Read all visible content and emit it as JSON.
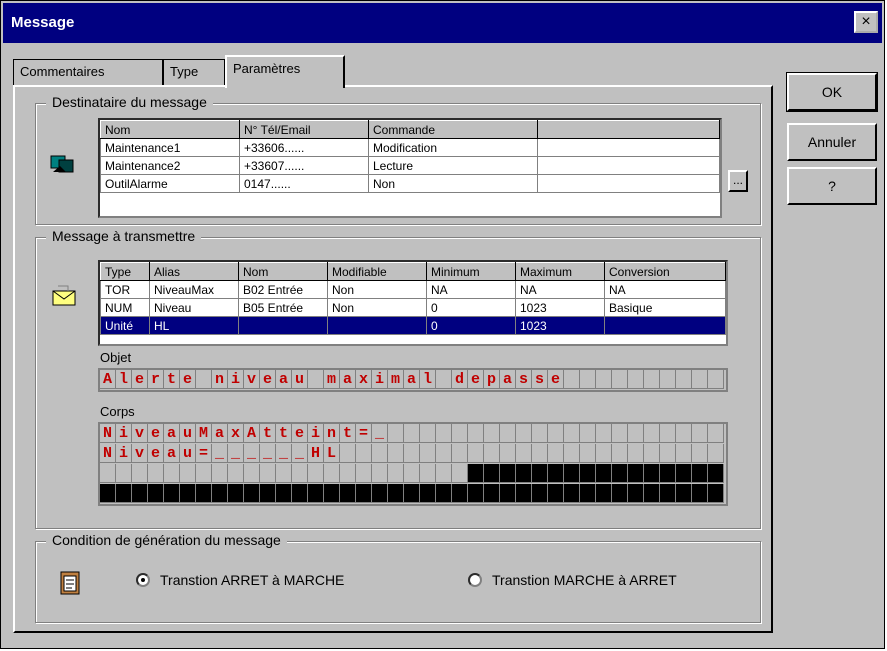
{
  "window": {
    "title": "Message",
    "close": "×"
  },
  "tabs": [
    "Commentaires",
    "Type",
    "Paramètres"
  ],
  "buttons": {
    "ok": "OK",
    "cancel": "Annuler",
    "help": "?"
  },
  "recipients": {
    "legend": "Destinataire du message",
    "columns": [
      "Nom",
      "N° Tél/Email",
      "Commande",
      ""
    ],
    "rows": [
      [
        "Maintenance1",
        "+33606......",
        "Modification",
        ""
      ],
      [
        "Maintenance2",
        "+33607......",
        "Lecture",
        ""
      ],
      [
        "OutilAlarme",
        "0147......",
        "Non",
        ""
      ]
    ],
    "browse": "..."
  },
  "message": {
    "legend": "Message à transmettre",
    "columns": [
      "Type",
      "Alias",
      "Nom",
      "Modifiable",
      "Minimum",
      "Maximum",
      "Conversion"
    ],
    "rows": [
      [
        "TOR",
        "NiveauMax",
        "B02 Entrée",
        "Non",
        "NA",
        "NA",
        "NA"
      ],
      [
        "NUM",
        "Niveau",
        "B05 Entrée",
        "Non",
        "0",
        "1023",
        "Basique"
      ],
      [
        "Unité",
        "HL",
        "",
        "",
        "0",
        "1023",
        ""
      ]
    ],
    "object_label": "Objet",
    "object_text": "Alerte niveau maximal depasse",
    "body_label": "Corps",
    "body_lines": [
      "NiveauMaxAtteint=_",
      "Niveau=______HL"
    ]
  },
  "condition": {
    "legend": "Condition de génération du message",
    "option1": "Transtion ARRET à MARCHE",
    "option2": "Transtion MARCHE à ARRET",
    "selected": 1
  },
  "colors": {
    "title_bar": "#000080",
    "lcd_text": "#c00000",
    "face": "#c0c0c0"
  }
}
